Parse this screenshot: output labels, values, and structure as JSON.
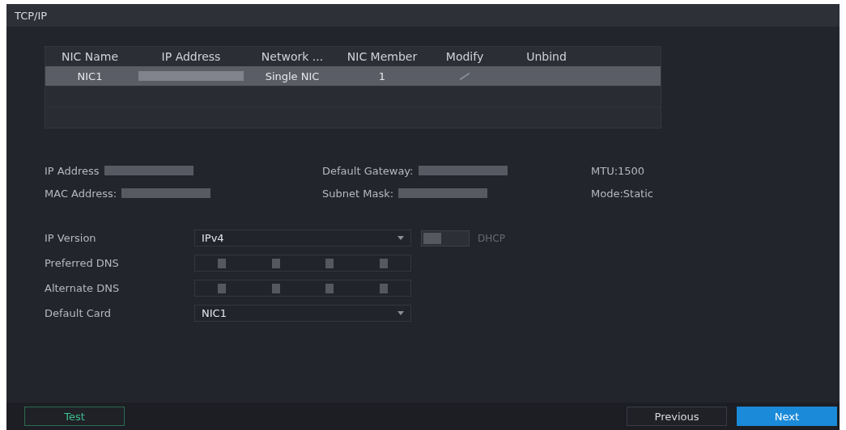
{
  "window": {
    "title": "TCP/IP"
  },
  "table": {
    "columns": [
      "NIC Name",
      "IP Address",
      "Network ...",
      "NIC Member",
      "Modify",
      "Unbind"
    ],
    "rows": [
      {
        "nic_name": "NIC1",
        "network": "Single NIC",
        "nic_member": "1",
        "selected": true
      }
    ]
  },
  "info": [
    {
      "label": "IP Address"
    },
    {
      "label": "Default Gateway:"
    },
    {
      "label": "MTU:1500"
    },
    {
      "label": "MAC Address:"
    },
    {
      "label": "Subnet Mask:"
    },
    {
      "label": "Mode:Static"
    }
  ],
  "form": [
    {
      "kind": "select",
      "label": "IP Version",
      "value": "IPv4"
    },
    {
      "kind": "ip",
      "label": "Preferred DNS"
    },
    {
      "kind": "ip",
      "label": "Alternate DNS"
    },
    {
      "kind": "select",
      "label": "Default Card",
      "value": "NIC1"
    }
  ],
  "dhcp": {
    "label": "DHCP",
    "checked": false,
    "disabled": true
  },
  "buttons": [
    {
      "label": "Test",
      "kind": "outline"
    },
    {
      "label": "Previous",
      "kind": "plain"
    },
    {
      "label": "Next",
      "kind": "primary"
    }
  ]
}
